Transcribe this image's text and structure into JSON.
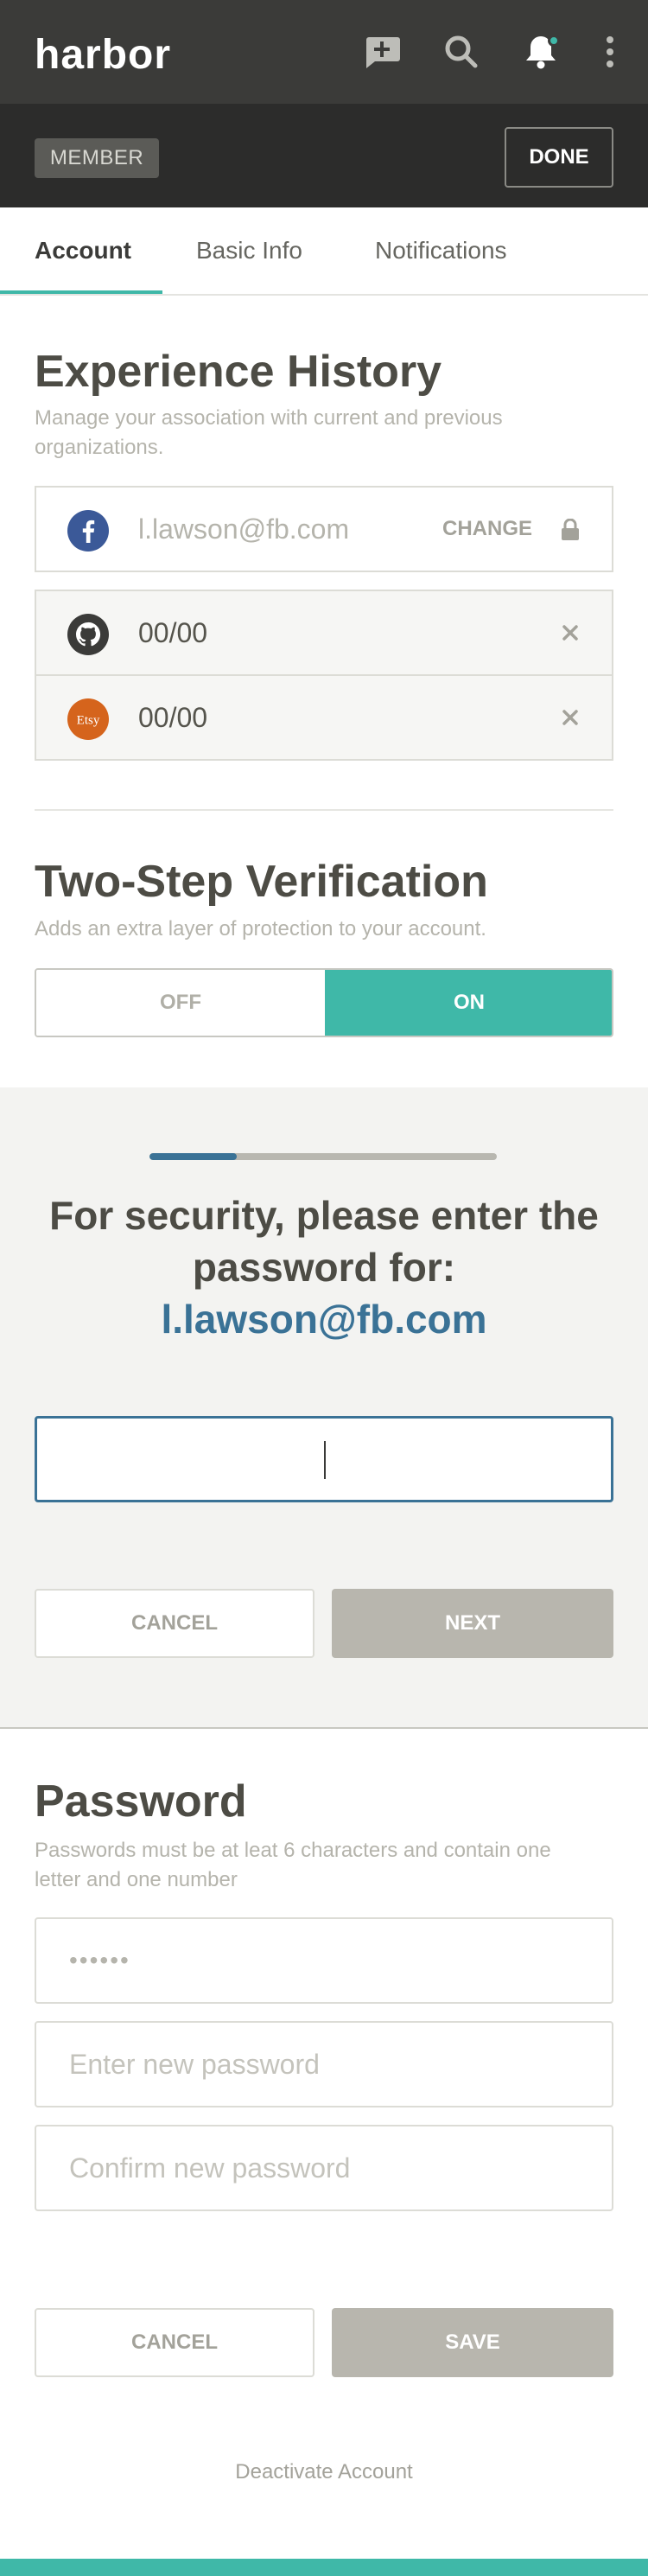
{
  "header": {
    "logo": "harbor",
    "icons": [
      "chat-plus-icon",
      "search-icon",
      "bell-icon",
      "more-vertical-icon"
    ],
    "member_badge": "MEMBER",
    "done_label": "DONE"
  },
  "tabs": [
    {
      "label": "Account",
      "active": true
    },
    {
      "label": "Basic Info",
      "active": false
    },
    {
      "label": "Notifications",
      "active": false
    }
  ],
  "experience": {
    "title": "Experience History",
    "description": "Manage your association with current and previous organizations.",
    "accounts": [
      {
        "icon": "facebook-icon",
        "value": "l.lawson@fb.com",
        "action": "CHANGE",
        "locked": true
      },
      {
        "icon": "github-icon",
        "value": "00/00",
        "removable": true
      },
      {
        "icon": "etsy-icon",
        "icon_text": "Etsy",
        "value": "00/00",
        "removable": true
      }
    ]
  },
  "two_step": {
    "title": "Two-Step Verification",
    "description": "Adds an extra layer of protection to your account.",
    "off_label": "OFF",
    "on_label": "ON",
    "selected": "ON"
  },
  "verify": {
    "progress": 0.25,
    "heading": "For security, please enter the password for:",
    "email": "l.lawson@fb.com",
    "input_value": "",
    "cancel_label": "CANCEL",
    "next_label": "NEXT"
  },
  "password": {
    "title": "Password",
    "description": "Passwords must be at leat 6 characters and contain one letter and one number",
    "current_value": "••••••",
    "new_placeholder": "Enter new password",
    "confirm_placeholder": "Confirm new password",
    "cancel_label": "CANCEL",
    "save_label": "SAVE"
  },
  "deactivate_label": "Deactivate Account",
  "colors": {
    "accent": "#3fb8a8",
    "link": "#3a7296",
    "header_bg": "#3b3b39",
    "facebook": "#3b5998",
    "etsy": "#d5641c"
  }
}
